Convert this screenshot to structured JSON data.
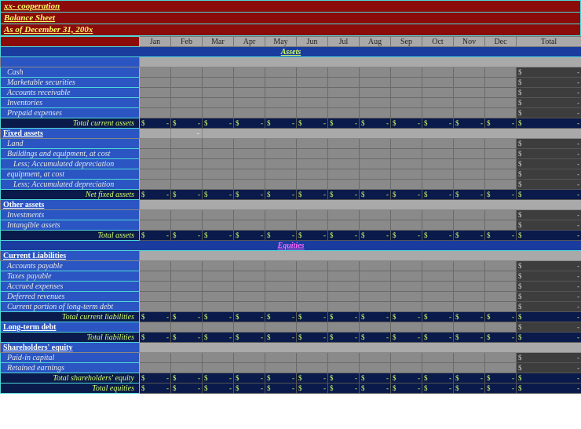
{
  "header": {
    "company": "xx- cooperation",
    "doc": "Balance Sheet",
    "asof": "As of December 31, 200x"
  },
  "months": [
    "Jan",
    "Feb",
    "Mar",
    "Apr",
    "May",
    "Jun",
    "Jul",
    "Aug",
    "Sep",
    "Oct",
    "Nov",
    "Dec",
    "Total"
  ],
  "sections": {
    "assets": "Assets",
    "equities": "Equities"
  },
  "groups": {
    "fixed": "Fixed assets",
    "other": "Other assets",
    "curliab": "Current Liabilities",
    "ltd": "Long-term debt",
    "sheq": "Shareholders' equity"
  },
  "rows": {
    "cash": "Cash",
    "msec": "Marketable securities",
    "ar": "Accounts receivable",
    "inv": "Inventories",
    "prep": "Prepaid expenses",
    "tca": "Total current assets",
    "land": "Land",
    "beq": "Buildings and equipment, at cost",
    "bdep": "Less; Accumulated depreciation",
    "eq": "equipment, at cost",
    "edep": "Less; Accumulated depreciation",
    "nfa": "Net fixed assets",
    "invst": "Investments",
    "intan": "Intangible assets",
    "ta": "Total  assets",
    "ap": "Accounts payable",
    "tp": "Taxes payable",
    "ae": "Accrued expenses",
    "dr": "Deferred revenues",
    "cpltd": "Current portion of long-term debt",
    "tcl": "Total current liabilities",
    "tl": "Total liabilities",
    "pic": "Paid-in capital",
    "re": "Retained earnings",
    "tse": "Total shareholders' equity",
    "te": "Total equities"
  },
  "val": {
    "dollar": "$",
    "dash": "-"
  }
}
